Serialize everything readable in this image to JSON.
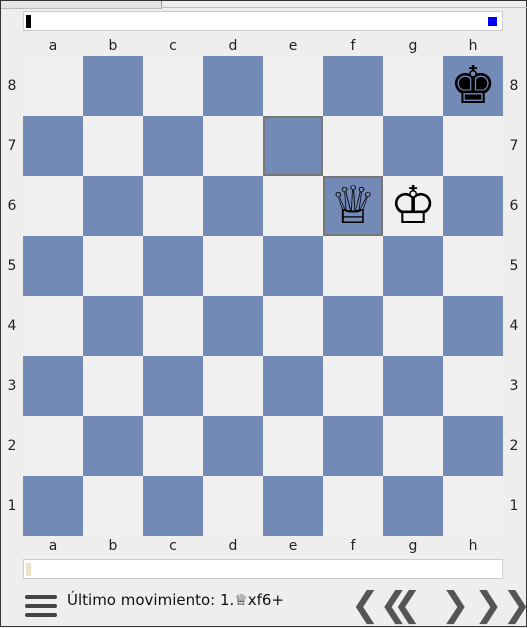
{
  "files": [
    "a",
    "b",
    "c",
    "d",
    "e",
    "f",
    "g",
    "h"
  ],
  "ranks": [
    "8",
    "7",
    "6",
    "5",
    "4",
    "3",
    "2",
    "1"
  ],
  "board": {
    "light_color": "#f0f0f0",
    "dark_color": "#7389b6",
    "pieces": [
      {
        "square": "h8",
        "glyph": "♚",
        "name": "black-king"
      },
      {
        "square": "f6",
        "glyph": "♕",
        "name": "white-queen"
      },
      {
        "square": "g6",
        "glyph": "♔",
        "name": "white-king"
      }
    ],
    "highlighted_squares": [
      "e7",
      "f6"
    ]
  },
  "footer": {
    "last_move": "Último movimiento: 1.♕xf6+",
    "nav_first": "❮❮",
    "nav_prev": "❮",
    "nav_next": "❯",
    "nav_last": "❯❯"
  }
}
